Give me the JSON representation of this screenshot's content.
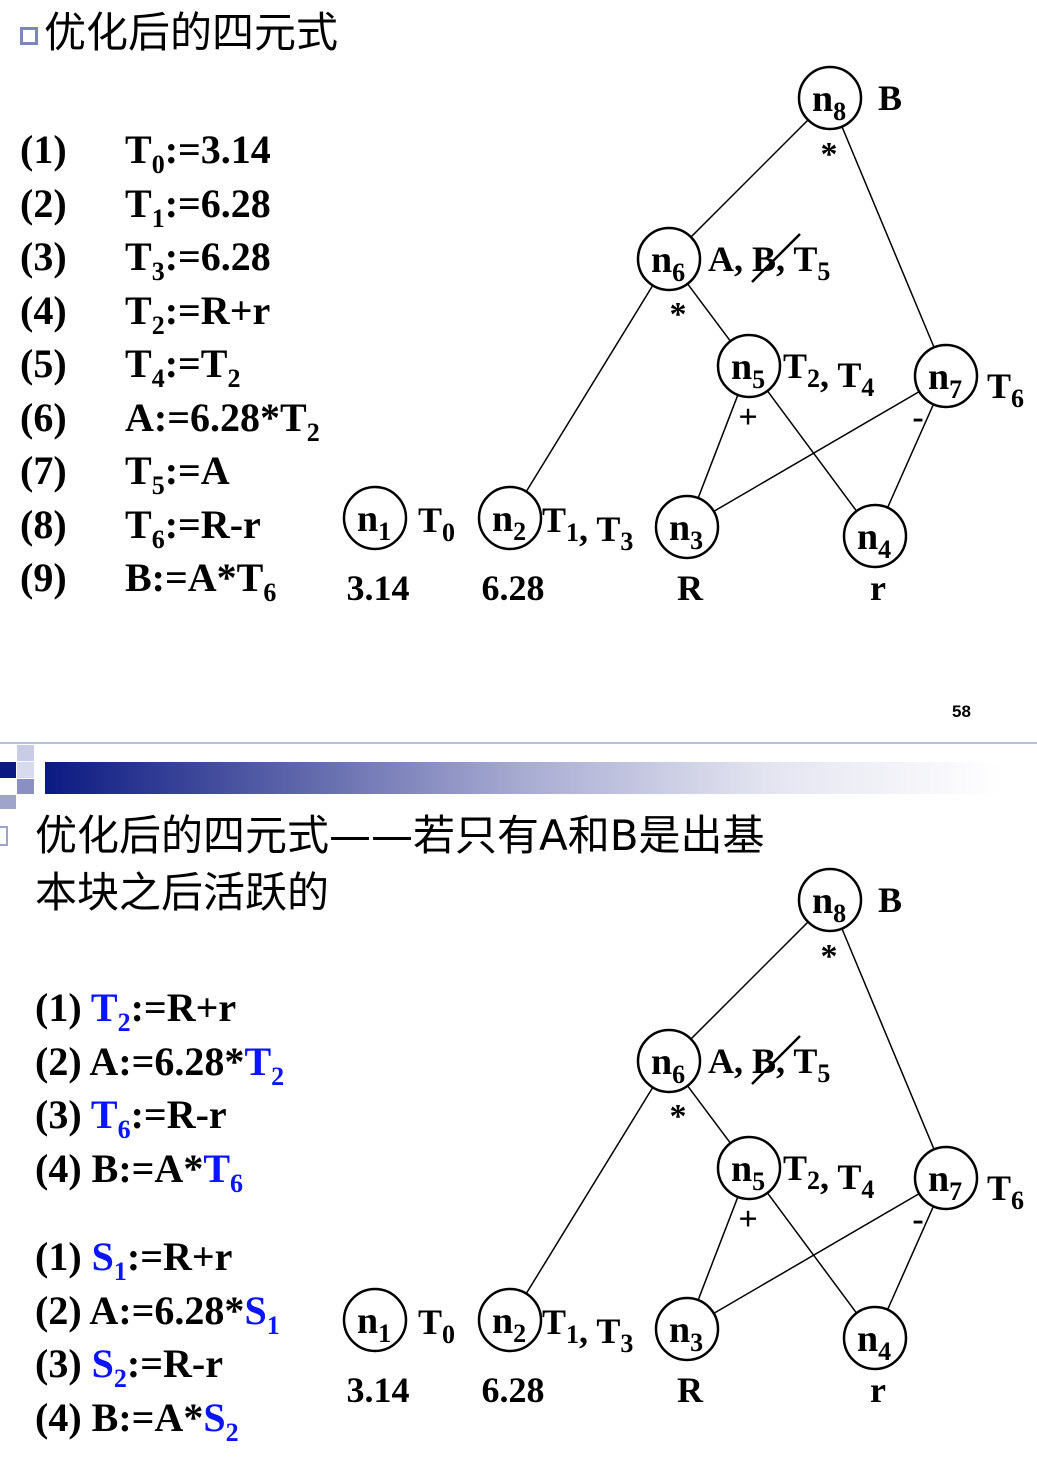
{
  "slide_top": {
    "title": "优化后的四元式",
    "quads": [
      {
        "idx": "(1)",
        "parts": [
          {
            "t": "T"
          },
          {
            "t": "0",
            "sub": true
          },
          {
            "t": ":=3.14"
          }
        ]
      },
      {
        "idx": "(2)",
        "parts": [
          {
            "t": "T"
          },
          {
            "t": "1",
            "sub": true
          },
          {
            "t": ":=6.28"
          }
        ]
      },
      {
        "idx": "(3)",
        "parts": [
          {
            "t": "T"
          },
          {
            "t": "3",
            "sub": true
          },
          {
            "t": ":=6.28"
          }
        ]
      },
      {
        "idx": "(4)",
        "parts": [
          {
            "t": "T"
          },
          {
            "t": "2",
            "sub": true
          },
          {
            "t": ":=R+r"
          }
        ]
      },
      {
        "idx": "(5)",
        "parts": [
          {
            "t": "T"
          },
          {
            "t": "4",
            "sub": true
          },
          {
            "t": ":=T"
          },
          {
            "t": "2",
            "sub": true
          }
        ]
      },
      {
        "idx": "(6)",
        "parts": [
          {
            "t": "A:=6.28*T"
          },
          {
            "t": "2",
            "sub": true
          }
        ]
      },
      {
        "idx": "(7)",
        "parts": [
          {
            "t": "T"
          },
          {
            "t": "5",
            "sub": true
          },
          {
            "t": ":=A"
          }
        ]
      },
      {
        "idx": "(8)",
        "parts": [
          {
            "t": "T"
          },
          {
            "t": "6",
            "sub": true
          },
          {
            "t": ":=R-r"
          }
        ]
      },
      {
        "idx": "(9)",
        "parts": [
          {
            "t": " B:=A*T"
          },
          {
            "t": "6",
            "sub": true
          }
        ]
      }
    ],
    "page_number": "58"
  },
  "slide_bottom": {
    "title_line1": "优化后的四元式——若只有A和B是出基",
    "title_line2": "本块之后活跃的",
    "quads_t": [
      [
        {
          "t": "(1) "
        },
        {
          "t": "T",
          "blue": true
        },
        {
          "t": "2",
          "sub": true,
          "blue": true
        },
        {
          "t": ":=R+r"
        }
      ],
      [
        {
          "t": "(2) A:=6.28*"
        },
        {
          "t": "T",
          "blue": true
        },
        {
          "t": "2",
          "sub": true,
          "blue": true
        }
      ],
      [
        {
          "t": "(3) "
        },
        {
          "t": "T",
          "blue": true
        },
        {
          "t": "6",
          "sub": true,
          "blue": true
        },
        {
          "t": ":=R-r"
        }
      ],
      [
        {
          "t": "(4) B:=A*"
        },
        {
          "t": "T",
          "blue": true
        },
        {
          "t": "6",
          "sub": true,
          "blue": true
        }
      ]
    ],
    "quads_s": [
      [
        {
          "t": "(1) "
        },
        {
          "t": "S",
          "blue": true
        },
        {
          "t": "1",
          "sub": true,
          "blue": true
        },
        {
          "t": ":=R+r"
        }
      ],
      [
        {
          "t": "(2) A:=6.28*"
        },
        {
          "t": "S",
          "blue": true
        },
        {
          "t": "1",
          "sub": true,
          "blue": true
        }
      ],
      [
        {
          "t": "(3) "
        },
        {
          "t": "S",
          "blue": true
        },
        {
          "t": "2",
          "sub": true,
          "blue": true
        },
        {
          "t": ":=R-r"
        }
      ],
      [
        {
          "t": "(4) B:=A*"
        },
        {
          "t": "S",
          "blue": true
        },
        {
          "t": "2",
          "sub": true,
          "blue": true
        }
      ]
    ]
  },
  "dag": {
    "nodes": [
      {
        "id": "n8",
        "sub": "8",
        "op": "*",
        "labels": [
          {
            "t": "B"
          }
        ]
      },
      {
        "id": "n6",
        "sub": "6",
        "op": "*",
        "labels": [
          {
            "t": "A"
          },
          {
            "t": "B",
            "struck": true
          },
          {
            "t": "T",
            "s": "5"
          }
        ]
      },
      {
        "id": "n5",
        "sub": "5",
        "op": "+",
        "labels": [
          {
            "t": "T",
            "s": "2"
          },
          {
            "t": "T",
            "s": "4"
          }
        ]
      },
      {
        "id": "n7",
        "sub": "7",
        "op": "-",
        "labels": [
          {
            "t": "T",
            "s": "6"
          }
        ]
      },
      {
        "id": "n1",
        "sub": "1",
        "leaf": "3.14",
        "labels": [
          {
            "t": "T",
            "s": "0"
          }
        ]
      },
      {
        "id": "n2",
        "sub": "2",
        "leaf": "6.28",
        "labels": [
          {
            "t": "T",
            "s": "1"
          },
          {
            "t": "T",
            "s": "3"
          }
        ]
      },
      {
        "id": "n3",
        "sub": "3",
        "leaf": "R",
        "labels": []
      },
      {
        "id": "n4",
        "sub": "4",
        "leaf": "r",
        "labels": []
      }
    ],
    "edges": [
      [
        "n8",
        "n6"
      ],
      [
        "n8",
        "n7"
      ],
      [
        "n6",
        "n2"
      ],
      [
        "n6",
        "n5"
      ],
      [
        "n5",
        "n3"
      ],
      [
        "n5",
        "n4"
      ],
      [
        "n7",
        "n3"
      ],
      [
        "n7",
        "n4"
      ]
    ],
    "colors": {
      "line": "#000000",
      "accent": "#0a14ff",
      "bar_start": "#0b1a82"
    }
  }
}
